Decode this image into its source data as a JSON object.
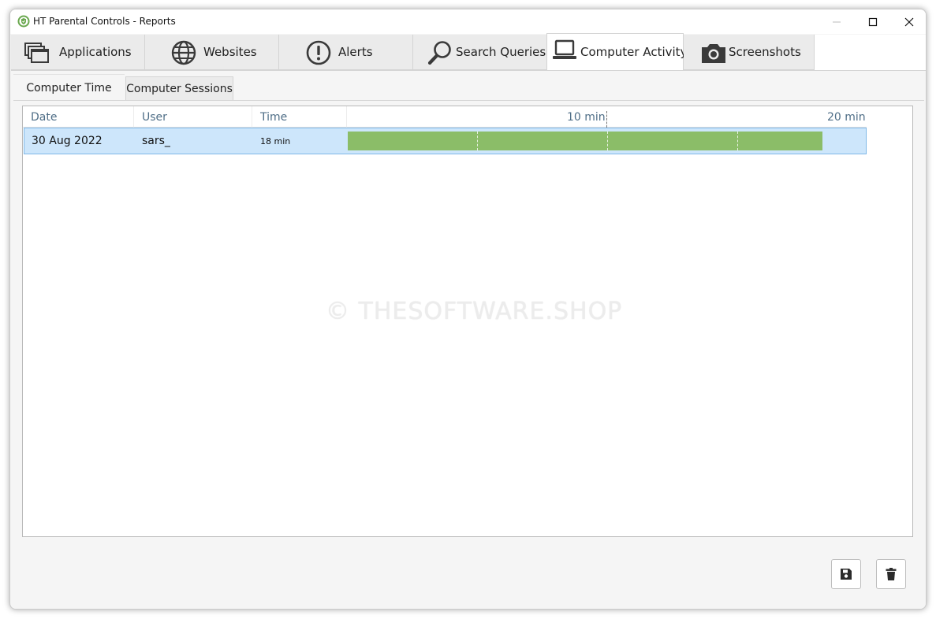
{
  "window": {
    "title": "HT Parental Controls - Reports",
    "icon": "shield-check-icon",
    "controls": [
      "minimize-icon",
      "maximize-icon",
      "close-icon"
    ]
  },
  "main_tabs": [
    {
      "label": "Applications",
      "icon": "windows-stack-icon",
      "active": false
    },
    {
      "label": "Websites",
      "icon": "globe-icon",
      "active": false
    },
    {
      "label": "Alerts",
      "icon": "exclamation-circle-icon",
      "active": false
    },
    {
      "label": "Search Queries",
      "icon": "magnifier-icon",
      "active": false
    },
    {
      "label": "Computer Activity",
      "icon": "laptop-icon",
      "active": true
    },
    {
      "label": "Screenshots",
      "icon": "camera-icon",
      "active": false
    }
  ],
  "sub_tabs": [
    {
      "label": "Computer Time",
      "active": true
    },
    {
      "label": "Computer Sessions",
      "active": false
    }
  ],
  "table": {
    "columns": [
      "Date",
      "User",
      "Time"
    ],
    "scale_labels": [
      "10 min",
      "20 min"
    ],
    "rows": [
      {
        "date": "30 Aug 2022",
        "user": "sars_",
        "time": "18 min",
        "minutes": 18,
        "selected": true
      }
    ]
  },
  "watermark": "© THESOFTWARE.SHOP",
  "actions": {
    "save_icon": "floppy-disk-icon",
    "delete_icon": "trash-icon"
  },
  "colors": {
    "bar": "#8bbd68",
    "selected_row": "#cde6fb",
    "header_text": "#4f6e87",
    "app_icon": "#6aa84f"
  }
}
